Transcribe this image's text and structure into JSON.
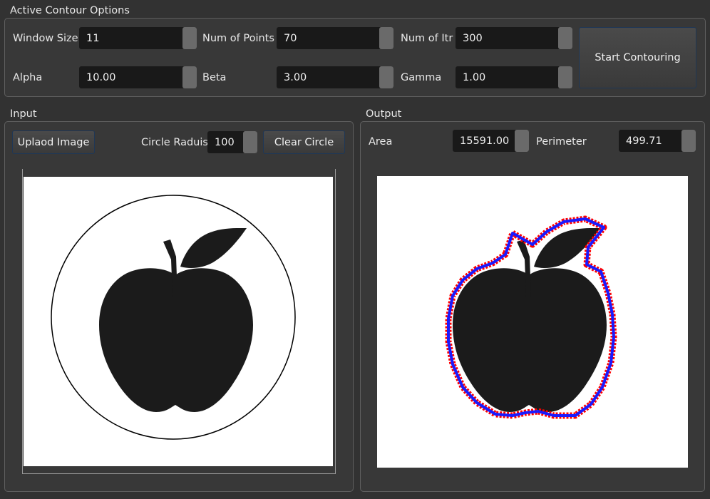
{
  "options": {
    "title": "Active Contour Options",
    "window_size": {
      "label": "Window Size",
      "value": "11"
    },
    "num_points": {
      "label": "Num of Points",
      "value": "70"
    },
    "num_itr": {
      "label": "Num of Itr",
      "value": "300"
    },
    "alpha": {
      "label": "Alpha",
      "value": "10.00"
    },
    "beta": {
      "label": "Beta",
      "value": "3.00"
    },
    "gamma": {
      "label": "Gamma",
      "value": "1.00"
    },
    "start_button": "Start Contouring"
  },
  "input": {
    "title": "Input",
    "upload_button": "Uplaod Image",
    "circle_radius": {
      "label": "Circle Raduis",
      "value": "100"
    },
    "clear_button": "Clear Circle"
  },
  "output": {
    "title": "Output",
    "area": {
      "label": "Area",
      "value": "15591.00"
    },
    "perimeter": {
      "label": "Perimeter",
      "value": "499.71"
    }
  },
  "colors": {
    "contour_outer": "#ff0000",
    "contour_inner": "#1a1aff",
    "apple": "#1b1b1b"
  }
}
